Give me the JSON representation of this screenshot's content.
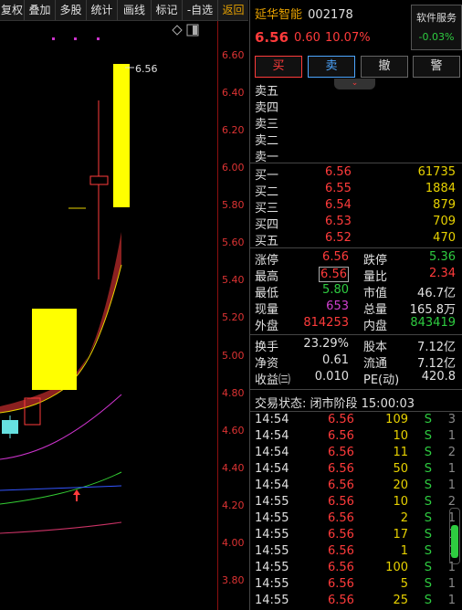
{
  "toolbar": {
    "items": [
      "复权",
      "叠加",
      "多股",
      "统计",
      "画线",
      "标记",
      "-自选",
      "返回"
    ]
  },
  "chart": {
    "axis_labels": [
      "6.60",
      "6.40",
      "6.20",
      "6.00",
      "5.80",
      "5.60",
      "5.40",
      "5.20",
      "5.00",
      "4.80",
      "4.60",
      "4.40",
      "4.20",
      "4.00",
      "3.80"
    ],
    "high_label": "6.56",
    "colors": {
      "up": "#ffff00",
      "band": "#8b2020",
      "ma_magenta": "#cc33cc",
      "ma_green": "#33cc33",
      "ma_blue": "#3355ff",
      "ma_pink": "#cc3366",
      "axis_red": "#dd3333"
    }
  },
  "header": {
    "name": "延华智能",
    "code": "002178",
    "price": "6.56",
    "change": "0.60",
    "pct": "10.07%",
    "service_label": "软件服务",
    "service_value": "-0.03%"
  },
  "trade_buttons": [
    "买",
    "卖",
    "撤",
    "警"
  ],
  "sell_orders": [
    {
      "label": "卖五",
      "price": "",
      "vol": ""
    },
    {
      "label": "卖四",
      "price": "",
      "vol": ""
    },
    {
      "label": "卖三",
      "price": "",
      "vol": ""
    },
    {
      "label": "卖二",
      "price": "",
      "vol": ""
    },
    {
      "label": "卖一",
      "price": "",
      "vol": ""
    }
  ],
  "buy_orders": [
    {
      "label": "买一",
      "price": "6.56",
      "vol": "61735"
    },
    {
      "label": "买二",
      "price": "6.55",
      "vol": "1884"
    },
    {
      "label": "买三",
      "price": "6.54",
      "vol": "879"
    },
    {
      "label": "买四",
      "price": "6.53",
      "vol": "709"
    },
    {
      "label": "买五",
      "price": "6.52",
      "vol": "470"
    }
  ],
  "stats1": [
    {
      "l1": "涨停",
      "v1": "6.56",
      "l2": "跌停",
      "v2": "5.36"
    },
    {
      "l1": "最高",
      "v1": "6.56",
      "l2": "量比",
      "v2": "2.34"
    },
    {
      "l1": "最低",
      "v1": "5.80",
      "l2": "市值",
      "v2": "46.7亿"
    },
    {
      "l1": "现量",
      "v1": "653",
      "l2": "总量",
      "v2": "165.8万"
    },
    {
      "l1": "外盘",
      "v1": "814253",
      "l2": "内盘",
      "v2": "843419"
    }
  ],
  "stats2": [
    {
      "l1": "换手",
      "v1": "23.29%",
      "l2": "股本",
      "v2": "7.12亿"
    },
    {
      "l1": "净资",
      "v1": "0.61",
      "l2": "流通",
      "v2": "7.12亿"
    },
    {
      "l1": "收益㈢",
      "v1": "0.010",
      "l2": "PE(动)",
      "v2": "420.8"
    }
  ],
  "status": "交易状态: 闭市阶段 15:00:03",
  "ticks": [
    {
      "time": "14:54",
      "price": "6.56",
      "vol": "109",
      "side": "S",
      "n": "3"
    },
    {
      "time": "14:54",
      "price": "6.56",
      "vol": "10",
      "side": "S",
      "n": "1"
    },
    {
      "time": "14:54",
      "price": "6.56",
      "vol": "11",
      "side": "S",
      "n": "2"
    },
    {
      "time": "14:54",
      "price": "6.56",
      "vol": "50",
      "side": "S",
      "n": "1"
    },
    {
      "time": "14:54",
      "price": "6.56",
      "vol": "20",
      "side": "S",
      "n": "1"
    },
    {
      "time": "14:55",
      "price": "6.56",
      "vol": "10",
      "side": "S",
      "n": "2"
    },
    {
      "time": "14:55",
      "price": "6.56",
      "vol": "2",
      "side": "S",
      "n": "1"
    },
    {
      "time": "14:55",
      "price": "6.56",
      "vol": "17",
      "side": "S",
      "n": "1"
    },
    {
      "time": "14:55",
      "price": "6.56",
      "vol": "1",
      "side": "S",
      "n": "1"
    },
    {
      "time": "14:55",
      "price": "6.56",
      "vol": "100",
      "side": "S",
      "n": "1"
    },
    {
      "time": "14:55",
      "price": "6.56",
      "vol": "5",
      "side": "S",
      "n": "1"
    },
    {
      "time": "14:55",
      "price": "6.56",
      "vol": "25",
      "side": "S",
      "n": "1"
    }
  ]
}
